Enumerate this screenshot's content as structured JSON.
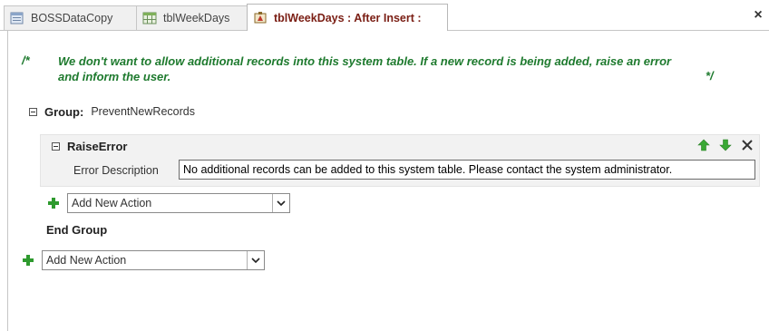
{
  "tabs": [
    {
      "label": "BOSSDataCopy",
      "icon": "database-icon",
      "active": false
    },
    {
      "label": "tblWeekDays",
      "icon": "table-icon",
      "active": false
    },
    {
      "label": "tblWeekDays : After Insert :",
      "icon": "macro-icon",
      "active": true
    }
  ],
  "window": {
    "close_label": "×"
  },
  "comment": {
    "open": "/*",
    "text": "We don't want to allow additional records into this system table. If a new record is being added, raise an error and inform the user.",
    "close": "*/"
  },
  "group": {
    "keyword": "Group:",
    "name": "PreventNewRecords",
    "end_label": "End Group"
  },
  "action": {
    "name": "RaiseError",
    "param_label": "Error Description",
    "param_value": "No additional records can be added to this system table. Please contact the system administrator."
  },
  "add_action": {
    "inner_placeholder": "Add New Action",
    "outer_placeholder": "Add New Action"
  },
  "colors": {
    "comment": "#1e7a2e",
    "active_tab_text": "#7a1e14",
    "arrows": "#3aa835",
    "plus": "#2e9a2e"
  }
}
